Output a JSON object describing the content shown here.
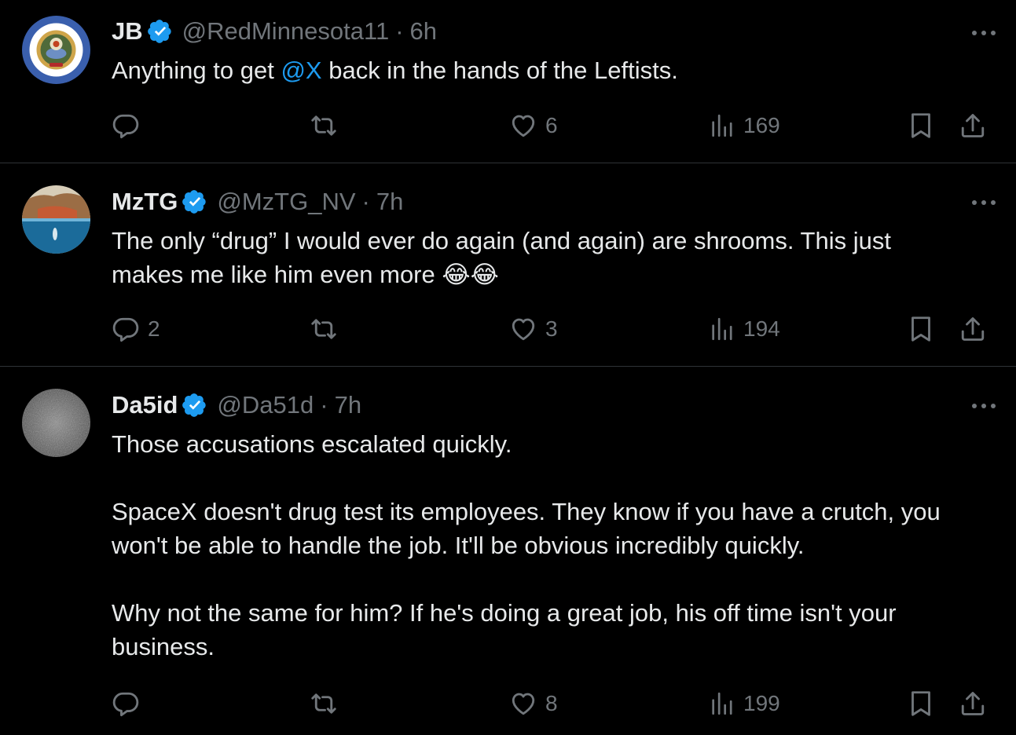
{
  "colors": {
    "background": "#000000",
    "text": "#e7e9ea",
    "muted": "#71767b",
    "accent": "#1d9bf0",
    "divider": "#2f3336"
  },
  "icons": {
    "verified": "verified-badge-icon",
    "more": "more-icon",
    "reply": "reply-icon",
    "retweet": "retweet-icon",
    "like": "heart-icon",
    "views": "views-icon",
    "bookmark": "bookmark-icon",
    "share": "share-icon"
  },
  "tweets": [
    {
      "name": "JB",
      "handle": "@RedMinnesota11",
      "separator": "·",
      "time": "6h",
      "text_before": "Anything to get ",
      "mention": "@X",
      "text_after": " back in the hands of the Leftists.",
      "replies": "",
      "retweets": "",
      "likes": "6",
      "views": "169"
    },
    {
      "name": "MzTG",
      "handle": "@MzTG_NV",
      "separator": "·",
      "time": "7h",
      "text": "The only “drug” I would ever do again (and again) are shrooms. This just makes me like him even more 😂😂",
      "replies": "2",
      "retweets": "",
      "likes": "3",
      "views": "194"
    },
    {
      "name": "Da5id",
      "handle": "@Da51d",
      "separator": "·",
      "time": "7h",
      "paragraphs": [
        "Those accusations escalated quickly.",
        "SpaceX doesn't drug test its employees. They know if you have a crutch, you won't be able to handle the job. It'll be obvious incredibly quickly.",
        "Why not the same for him? If he's doing a great job, his off time isn't your business."
      ],
      "replies": "",
      "retweets": "",
      "likes": "8",
      "views": "199"
    }
  ]
}
